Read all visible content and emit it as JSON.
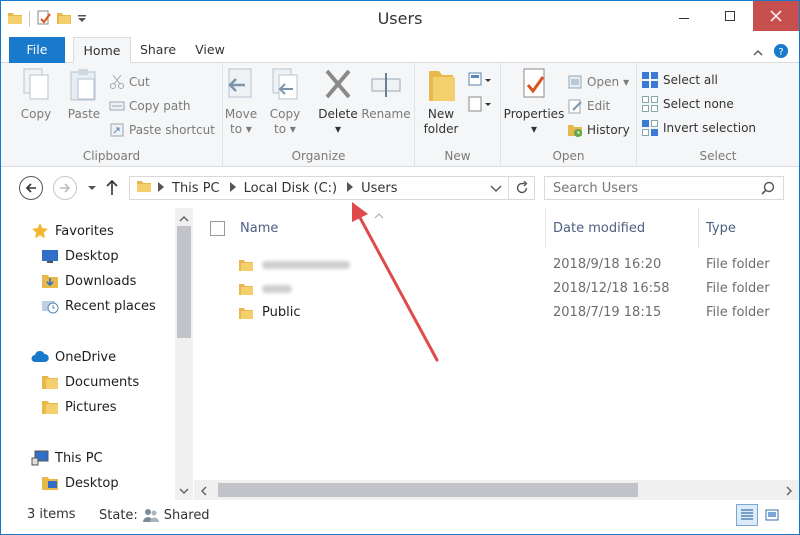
{
  "window": {
    "title": "Users"
  },
  "ribbon_tabs": {
    "file": "File",
    "home": "Home",
    "share": "Share",
    "view": "View"
  },
  "clipboard": {
    "label": "Clipboard",
    "copy": "Copy",
    "paste": "Paste",
    "cut": "Cut",
    "copy_path": "Copy path",
    "paste_shortcut": "Paste shortcut"
  },
  "organize": {
    "label": "Organize",
    "move_to_line1": "Move",
    "move_to_line2": "to",
    "copy_to_line1": "Copy",
    "copy_to_line2": "to",
    "delete": "Delete",
    "rename": "Rename"
  },
  "new_group": {
    "label": "New",
    "new_folder_line1": "New",
    "new_folder_line2": "folder"
  },
  "open_group": {
    "label": "Open",
    "properties": "Properties",
    "open": "Open",
    "edit": "Edit",
    "history": "History"
  },
  "select_group": {
    "label": "Select",
    "select_all": "Select all",
    "select_none": "Select none",
    "invert_selection": "Invert selection"
  },
  "address": {
    "crumbs": [
      "This PC",
      "Local Disk (C:)",
      "Users"
    ]
  },
  "search": {
    "placeholder": "Search Users"
  },
  "nav_tree": {
    "favorites": "Favorites",
    "desktop": "Desktop",
    "downloads": "Downloads",
    "recent_places": "Recent places",
    "onedrive": "OneDrive",
    "documents": "Documents",
    "pictures": "Pictures",
    "this_pc": "This PC",
    "pc_desktop": "Desktop"
  },
  "file_list": {
    "columns": {
      "name": "Name",
      "date_modified": "Date modified",
      "type": "Type"
    },
    "rows": [
      {
        "name": "",
        "date": "2018/9/18 16:20",
        "type": "File folder",
        "blurred": true
      },
      {
        "name": "",
        "date": "2018/12/18 16:58",
        "type": "File folder",
        "blurred": true
      },
      {
        "name": "Public",
        "date": "2018/7/19 18:15",
        "type": "File folder",
        "blurred": false
      }
    ]
  },
  "status": {
    "count": "3 items",
    "state_label": "State:",
    "state_value": "Shared"
  },
  "colors": {
    "accent": "#1979ca",
    "close": "#c7504f",
    "arrow": "#e04a4a",
    "folder": "#e8b84a"
  }
}
